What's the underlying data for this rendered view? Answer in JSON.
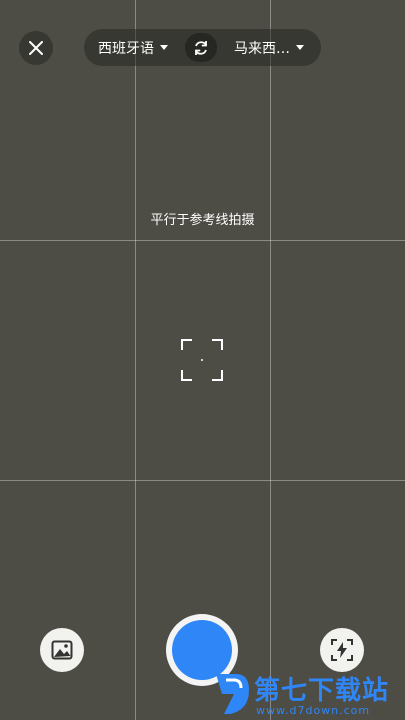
{
  "top_bar": {
    "source_language": "西班牙语",
    "target_language": "马来西…"
  },
  "hint_text": "平行于参考线拍摄",
  "icons": {
    "close": "close-icon",
    "swap": "swap-icon",
    "gallery": "image-icon",
    "flash": "flash-auto-icon",
    "focus": "focus-frame-icon"
  },
  "colors": {
    "background": "#4d4c45",
    "shutter": "#2f86f6"
  },
  "watermark": {
    "text": "第七下载站",
    "url": "www.d7down.com"
  }
}
